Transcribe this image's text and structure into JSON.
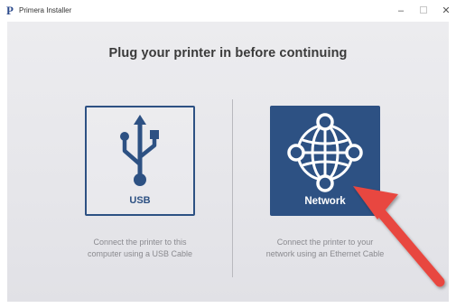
{
  "window": {
    "title": "Primera Installer",
    "logo_letter": "P",
    "controls": {
      "minimize": "–",
      "maximize_icon": "square",
      "close": "✕"
    }
  },
  "main": {
    "heading": "Plug your printer in before continuing",
    "options": [
      {
        "label": "USB",
        "icon": "usb-icon",
        "description_line1": "Connect the printer to this",
        "description_line2": "computer using a USB Cable"
      },
      {
        "label": "Network",
        "icon": "network-globe-icon",
        "description_line1": "Connect the printer to your",
        "description_line2": "network using an Ethernet Cable"
      }
    ]
  },
  "colors": {
    "accent": "#2d5183",
    "annotation_arrow": "#e8473f",
    "background": "#e8e8ec",
    "description_text": "#8a8a8f"
  },
  "annotation": {
    "type": "red-arrow-pointing-at-network"
  }
}
